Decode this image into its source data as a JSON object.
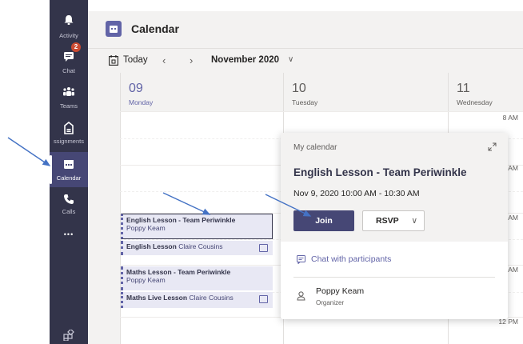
{
  "rail": {
    "items": [
      {
        "label": "Activity",
        "icon": "bell-icon"
      },
      {
        "label": "Chat",
        "icon": "chat-icon",
        "badge": "2"
      },
      {
        "label": "Teams",
        "icon": "teams-icon"
      },
      {
        "label": "ssignments",
        "icon": "assignments-icon"
      },
      {
        "label": "Calendar",
        "icon": "calendar-icon"
      },
      {
        "label": "Calls",
        "icon": "phone-icon"
      },
      {
        "label": "•••",
        "icon": "more-icon"
      }
    ],
    "active": "Calendar"
  },
  "header": {
    "title": "Calendar"
  },
  "nav": {
    "today_label": "Today",
    "prev": "‹",
    "next": "›",
    "month": "November 2020",
    "month_chevron": "∨"
  },
  "days": [
    {
      "num": "09",
      "name": "Monday"
    },
    {
      "num": "10",
      "name": "Tuesday"
    },
    {
      "num": "11",
      "name": "Wednesday"
    }
  ],
  "times": [
    "8 AM",
    "9 AM",
    "10 AM",
    "11 AM",
    "12 PM"
  ],
  "events": [
    {
      "title": "English Lesson - Team Periwinkle",
      "sub": "Poppy Keam"
    },
    {
      "title": "English Lesson",
      "sub": "Claire Cousins"
    },
    {
      "title": "Maths Lesson - Team Periwinkle",
      "sub": "Poppy Keam"
    },
    {
      "title": "Maths Live Lesson",
      "sub": "Claire Cousins"
    }
  ],
  "popup": {
    "calendar_label": "My calendar",
    "title": "English Lesson - Team Periwinkle",
    "time": "Nov 9, 2020 10:00 AM - 10:30 AM",
    "join_label": "Join",
    "rsvp_label": "RSVP",
    "rsvp_chevron": "∨",
    "chat_label": "Chat with participants",
    "organizer_name": "Poppy Keam",
    "organizer_role": "Organizer"
  },
  "colors": {
    "accent": "#6264a7",
    "rail": "#33344a",
    "annotation_arrow": "#4472c4"
  }
}
